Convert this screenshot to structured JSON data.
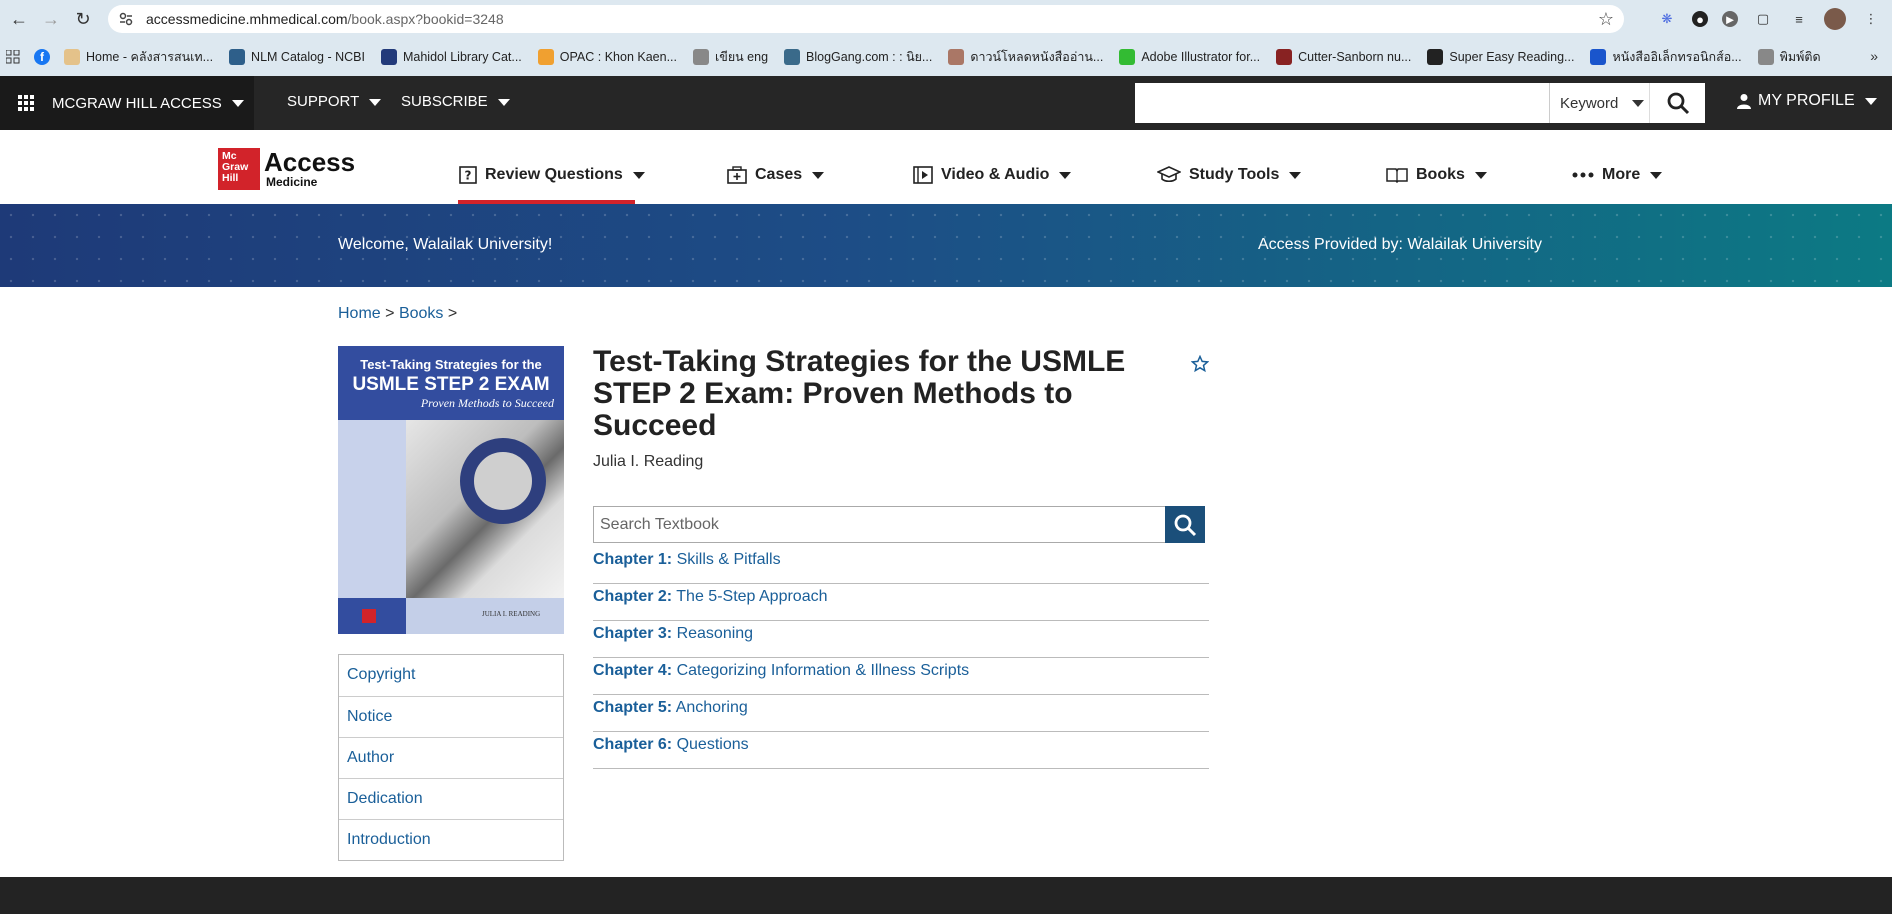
{
  "browser": {
    "url_host": "accessmedicine.mhmedical.com",
    "url_path": "/book.aspx?bookid=3248",
    "bookmarks": [
      {
        "label": "Home - คลังสารสนเท...",
        "color": "#e4c28a"
      },
      {
        "label": "NLM Catalog - NCBI",
        "color": "#2e5f8a"
      },
      {
        "label": "Mahidol Library Cat...",
        "color": "#223a7a"
      },
      {
        "label": "OPAC : Khon Kaen...",
        "color": "#f0a030"
      },
      {
        "label": "เขียน eng",
        "color": "#888888"
      },
      {
        "label": "BlogGang.com : : นิย...",
        "color": "#3a6a8a"
      },
      {
        "label": "ดาวน์โหลดหนังสืออ่าน...",
        "color": "#aa7766"
      },
      {
        "label": "Adobe Illustrator for...",
        "color": "#33bb33"
      },
      {
        "label": "Cutter-Sanborn nu...",
        "color": "#882222"
      },
      {
        "label": "Super Easy Reading...",
        "color": "#222222"
      },
      {
        "label": "หนังสืออิเล็กทรอนิกส์อ...",
        "color": "#1a55cc"
      },
      {
        "label": "พิมพ์ติด",
        "color": "#888888"
      }
    ]
  },
  "topbar": {
    "access_label": "MCGRAW HILL ACCESS",
    "support": "SUPPORT",
    "subscribe": "SUBSCRIBE",
    "search_placeholder": "",
    "search_mode": "Keyword",
    "profile": "MY PROFILE"
  },
  "logo": {
    "mg": "Mc Graw Hill",
    "access": "Access",
    "medicine": "Medicine"
  },
  "nav": {
    "review": "Review Questions",
    "cases": "Cases",
    "video": "Video & Audio",
    "study": "Study Tools",
    "books": "Books",
    "more": "More"
  },
  "banner": {
    "welcome": "Welcome, Walailak University!",
    "provided": "Access Provided by: Walailak University"
  },
  "breadcrumb": {
    "home": "Home",
    "books": "Books"
  },
  "cover": {
    "line1": "Test-Taking Strategies for the",
    "line2": "USMLE STEP 2 EXAM",
    "line3": "Proven Methods to Succeed",
    "author": "JULIA I. READING"
  },
  "book": {
    "title": "Test-Taking Strategies for the USMLE STEP 2 Exam: Proven Methods to Succeed",
    "author": "Julia I. Reading",
    "search_placeholder": "Search Textbook"
  },
  "side_links": [
    "Copyright",
    "Notice",
    "Author",
    "Dedication",
    "Introduction"
  ],
  "chapters": [
    {
      "num": "Chapter 1:",
      "title": "Skills & Pitfalls"
    },
    {
      "num": "Chapter 2:",
      "title": "The 5-Step Approach"
    },
    {
      "num": "Chapter 3:",
      "title": "Reasoning"
    },
    {
      "num": "Chapter 4:",
      "title": "Categorizing Information & Illness Scripts"
    },
    {
      "num": "Chapter 5:",
      "title": "Anchoring"
    },
    {
      "num": "Chapter 6:",
      "title": "Questions"
    }
  ],
  "colors": {
    "brand_red": "#d2232a",
    "link": "#1a5f99",
    "topbar": "#262626"
  }
}
